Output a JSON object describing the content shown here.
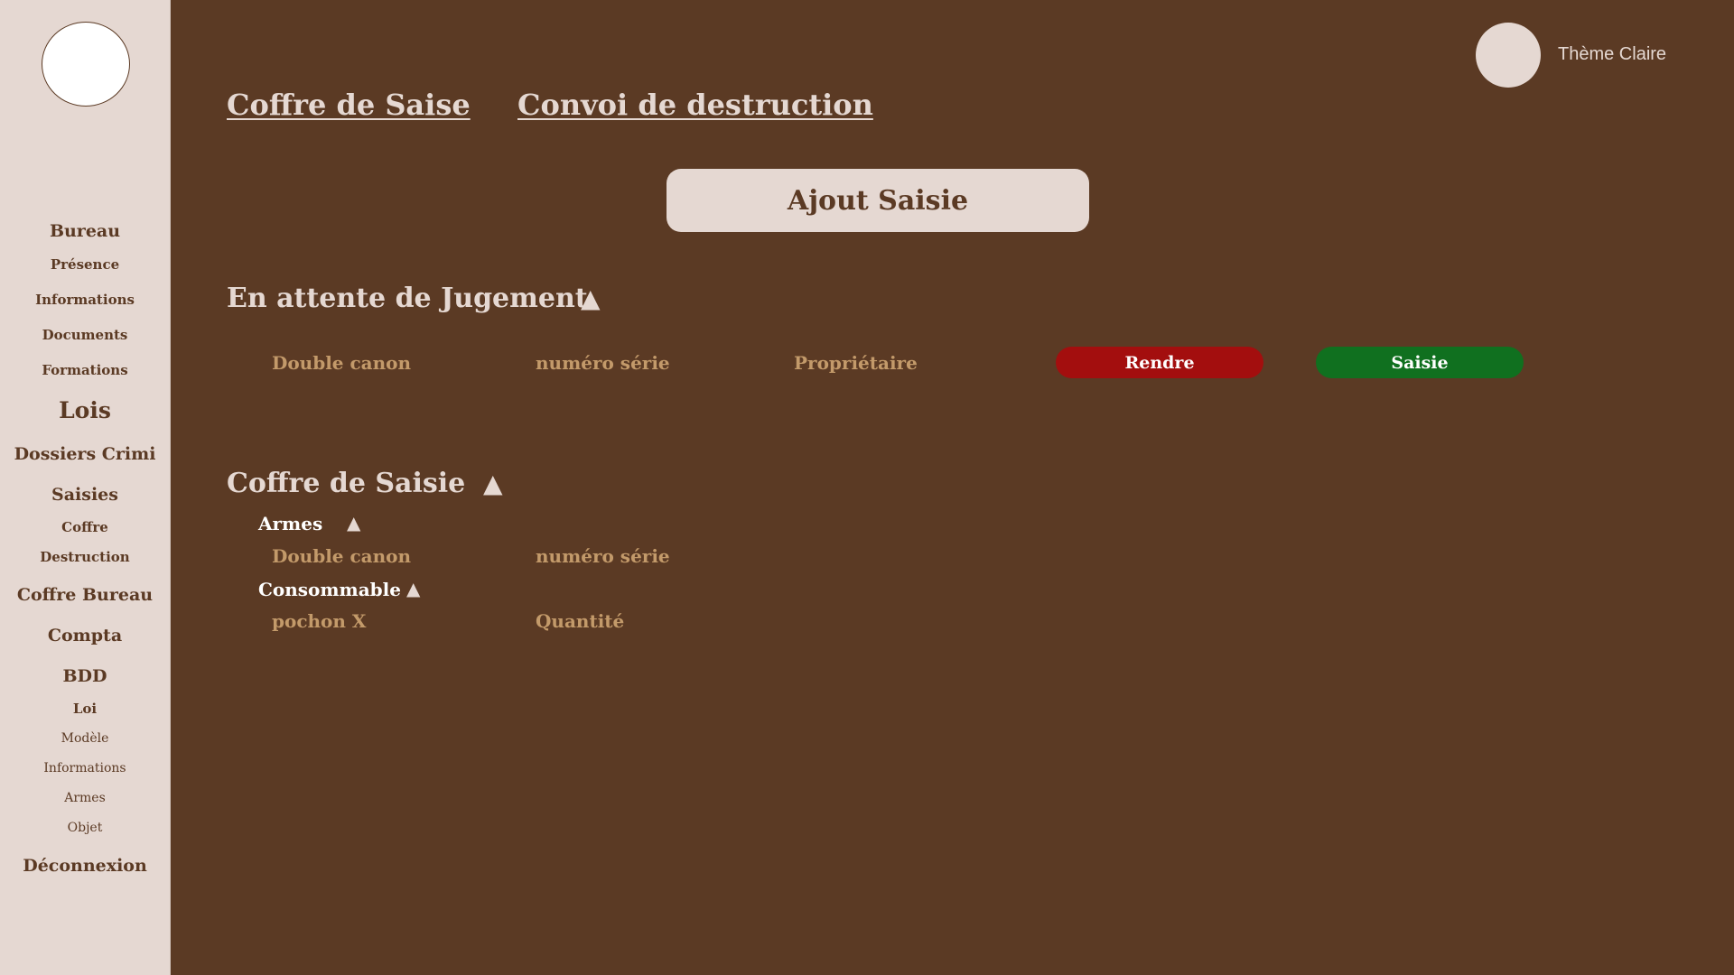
{
  "sidebar": {
    "items": [
      {
        "label": "Bureau"
      },
      {
        "label": "Présence"
      },
      {
        "label": "Informations"
      },
      {
        "label": "Documents"
      },
      {
        "label": "Formations"
      },
      {
        "label": "Lois"
      },
      {
        "label": "Dossiers Crimi"
      },
      {
        "label": "Saisies"
      },
      {
        "label": "Coffre"
      },
      {
        "label": "Destruction"
      },
      {
        "label": "Coffre Bureau"
      },
      {
        "label": "Compta"
      },
      {
        "label": "BDD"
      },
      {
        "label": "Loi"
      },
      {
        "label": "Modèle"
      },
      {
        "label": "Informations"
      },
      {
        "label": "Armes"
      },
      {
        "label": "Objet"
      },
      {
        "label": "Déconnexion"
      }
    ]
  },
  "header": {
    "links": [
      {
        "label": "Coffre de Saise"
      },
      {
        "label": "Convoi de destruction"
      }
    ],
    "theme_label": "Thème Claire"
  },
  "add_button_label": "Ajout Saisie",
  "pending": {
    "title": "En attente de Jugement",
    "toggle": "▲",
    "row": {
      "cells": [
        "Double canon",
        "numéro série",
        "Propriétaire"
      ],
      "return_label": "Rendre",
      "seize_label": "Saisie"
    }
  },
  "vault": {
    "title": "Coffre de Saisie",
    "toggle": "▲",
    "categories": [
      {
        "name": "Armes",
        "toggle": "▲",
        "cells": [
          "Double canon",
          "numéro série"
        ]
      },
      {
        "name": "Consommable",
        "toggle": "▲",
        "cells": [
          "pochon X",
          "Quantité"
        ]
      }
    ]
  },
  "colors": {
    "background": "#5b3a24",
    "sidebar": "#e5d8d2",
    "muted_text": "#c39a6a",
    "return_button": "#a30e0e",
    "seize_button": "#10701f"
  }
}
